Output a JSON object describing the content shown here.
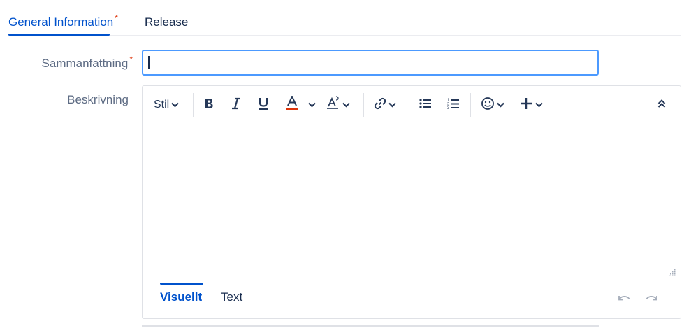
{
  "tabs": [
    {
      "label": "General Information",
      "required_mark": "*"
    },
    {
      "label": "Release"
    }
  ],
  "fields": {
    "summary": {
      "label": "Sammanfattning",
      "required_mark": "*",
      "value": ""
    },
    "description": {
      "label": "Beskrivning"
    }
  },
  "editor": {
    "toolbar": {
      "style_label": "Stil",
      "icons": [
        "bold-icon",
        "italic-icon",
        "underline-icon",
        "text-color-icon",
        "clear-format-icon",
        "link-icon",
        "bullet-list-icon",
        "numbered-list-icon",
        "emoji-icon",
        "insert-icon",
        "collapse-icon"
      ]
    },
    "content": "",
    "footer_tabs": [
      "Visuellt",
      "Text"
    ]
  },
  "colors": {
    "accent": "#0052cc",
    "required": "#de350b",
    "text_color_underline": "#de350b"
  }
}
